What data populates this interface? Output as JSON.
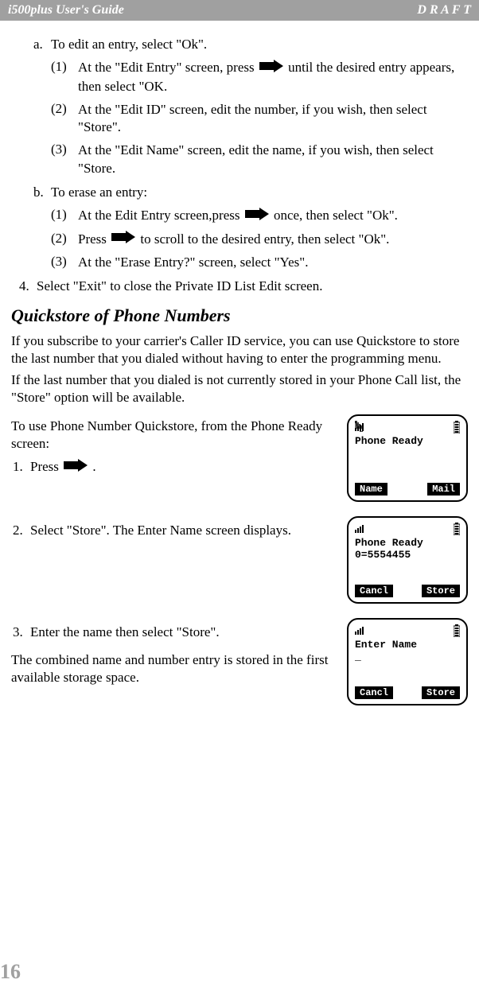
{
  "header": {
    "left": "i500plus User's Guide",
    "right": "D R A F T"
  },
  "a_text": "To edit an entry, select \"Ok\".",
  "a1_pre": "At the \"Edit Entry\" screen, press ",
  "a1_post": " until the desired entry appears, then select \"OK.",
  "a2": "At the \"Edit ID\" screen, edit the number, if you wish, then select \"Store\".",
  "a3": "At the \"Edit Name\" screen, edit the name, if you wish, then select \"Store.",
  "b_text": "To erase an entry:",
  "b1_pre": "At the Edit Entry screen,press ",
  "b1_post": " once, then select \"Ok\".",
  "b2_pre": "Press ",
  "b2_post": " to scroll to the desired entry, then select \"Ok\".",
  "b3": "At the \"Erase Entry?\" screen, select \"Yes\".",
  "step4": "Select \"Exit\" to close the Private ID List Edit screen.",
  "section_title": "Quickstore of Phone Numbers",
  "para1": "If you subscribe to your carrier's Caller ID service, you can use Quickstore to store the last number that you dialed without having to enter the programming menu.",
  "para2": "If the last number that you dialed is not currently stored in your Phone Call list, the \"Store\" option will be available.",
  "para3": "To use Phone Number Quickstore, from the Phone Ready screen:",
  "q1_pre": "Press ",
  "q1_post": ".",
  "q2": "Select \"Store\". The Enter Name screen displays.",
  "q3": "Enter the name then select \"Store\".",
  "para4": "The combined name and number entry is stored in the first available storage space.",
  "screen1": {
    "line1": "Phone Ready",
    "sk_left": "Name",
    "sk_right": "Mail"
  },
  "screen2": {
    "line1": "Phone Ready",
    "line2": "0=5554455",
    "sk_left": "Cancl",
    "sk_right": "Store"
  },
  "screen3": {
    "line1": "Enter Name",
    "line2": "_",
    "sk_left": "Cancl",
    "sk_right": "Store"
  },
  "page_number": "16"
}
